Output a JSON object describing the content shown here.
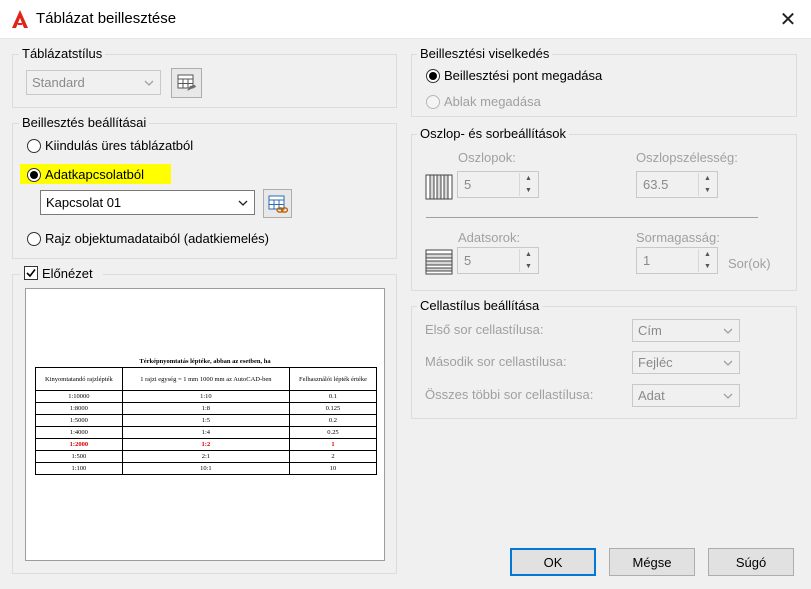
{
  "window": {
    "title": "Táblázat beillesztése"
  },
  "table_style": {
    "group_label": "Táblázatstílus",
    "selected": "Standard"
  },
  "insert_options": {
    "group_label": "Beillesztés beállításai",
    "option_empty": "Kiindulás üres táblázatból",
    "option_datalink": "Adatkapcsolatból",
    "datalink_selected": "Kapcsolat 01",
    "option_extract": "Rajz objektumadataiból (adatkiemelés)",
    "selected_option": "datalink",
    "highlight_color": "#ffff00"
  },
  "preview": {
    "label": "Előnézet",
    "checked": true,
    "table_title": "Térképnyomtatás léptéke, abban az esetben, ha",
    "columns": [
      "Kinyomtatandó rajzlépték",
      "1 rajzi egység = 1 mm 1000 mm az AutoCAD-ben",
      "Felhasználói lépték értéke"
    ],
    "rows": [
      [
        "1:10000",
        "1:10",
        "0.1"
      ],
      [
        "1:8000",
        "1:8",
        "0.125"
      ],
      [
        "1:5000",
        "1:5",
        "0.2"
      ],
      [
        "1:4000",
        "1:4",
        "0.25"
      ],
      [
        "1:2000",
        "1:2",
        "1"
      ],
      [
        "1:500",
        "2:1",
        "2"
      ],
      [
        "1:100",
        "10:1",
        "10"
      ]
    ],
    "highlight_row_index": 4,
    "highlight_row_color": "#e00000"
  },
  "insertion_behavior": {
    "group_label": "Beillesztési viselkedés",
    "option_point": "Beillesztési pont megadása",
    "option_window": "Ablak megadása",
    "selected_option": "point"
  },
  "column_row": {
    "group_label": "Oszlop- és sorbeállítások",
    "columns_label": "Oszlopok:",
    "columns_value": "5",
    "column_width_label": "Oszlopszélesség:",
    "column_width_value": "63.5",
    "data_rows_label": "Adatsorok:",
    "data_rows_value": "5",
    "row_height_label": "Sormagasság:",
    "row_height_value": "1",
    "row_height_unit": "Sor(ok)"
  },
  "cell_style": {
    "group_label": "Cellastílus beállítása",
    "first_row_label": "Első sor cellastílusa:",
    "first_row_value": "Cím",
    "second_row_label": "Második sor cellastílusa:",
    "second_row_value": "Fejléc",
    "other_rows_label": "Összes többi sor cellastílusa:",
    "other_rows_value": "Adat"
  },
  "buttons": {
    "ok": "OK",
    "cancel": "Mégse",
    "help": "Súgó"
  },
  "icons": {
    "app": "autocad-logo-icon",
    "close": "close-icon",
    "table_style_launch": "table-style-dialog-icon",
    "datalink_launch": "data-link-manager-icon",
    "columns": "columns-icon",
    "rows": "rows-icon"
  },
  "colors": {
    "accent_default_button": "#0078d7",
    "app_logo_red": "#e2231a"
  }
}
